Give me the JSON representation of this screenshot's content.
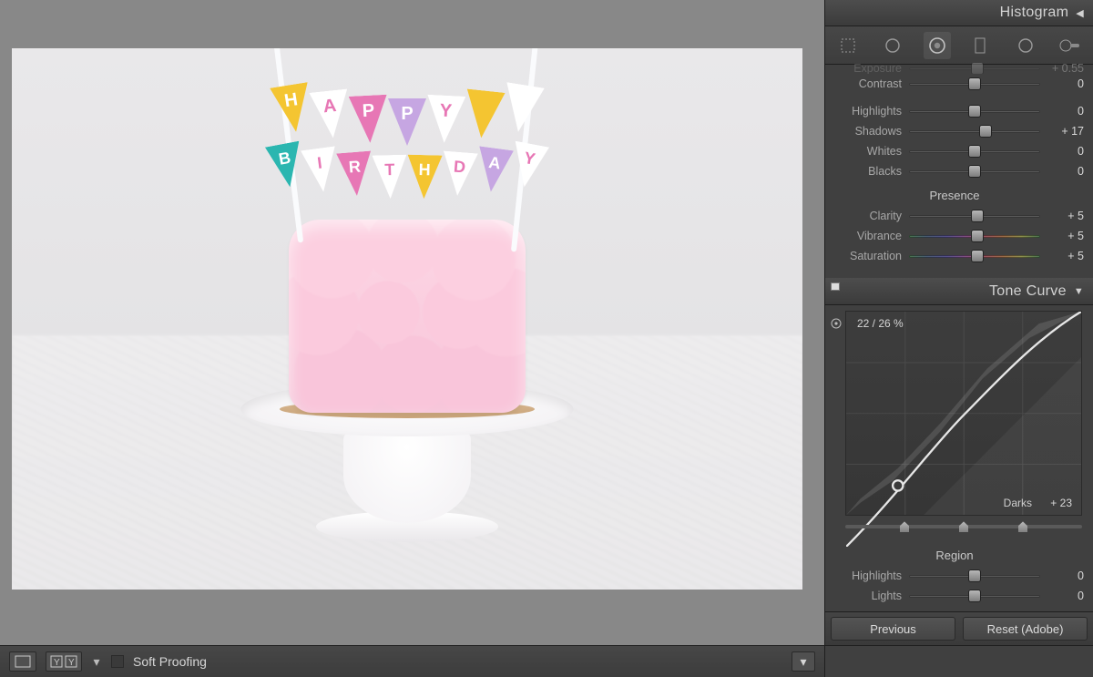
{
  "panels": {
    "histogram_title": "Histogram",
    "tone_curve_title": "Tone Curve",
    "region_title": "Region",
    "presence_title": "Presence"
  },
  "basic": {
    "exposure": {
      "label": "Exposure",
      "value": "+ 0.55",
      "pos": 52
    },
    "contrast": {
      "label": "Contrast",
      "value": "0",
      "pos": 50
    },
    "highlights": {
      "label": "Highlights",
      "value": "0",
      "pos": 50
    },
    "shadows": {
      "label": "Shadows",
      "value": "+ 17",
      "pos": 58
    },
    "whites": {
      "label": "Whites",
      "value": "0",
      "pos": 50
    },
    "blacks": {
      "label": "Blacks",
      "value": "0",
      "pos": 50
    }
  },
  "presence": {
    "clarity": {
      "label": "Clarity",
      "value": "+ 5",
      "pos": 52
    },
    "vibrance": {
      "label": "Vibrance",
      "value": "+ 5",
      "pos": 52
    },
    "saturation": {
      "label": "Saturation",
      "value": "+ 5",
      "pos": 52
    }
  },
  "tone_curve": {
    "readout": "22 / 26 %",
    "range_label": "Darks",
    "range_value": "+ 23",
    "splits": [
      25,
      50,
      75
    ]
  },
  "region": {
    "highlights": {
      "label": "Highlights",
      "value": "0",
      "pos": 50
    },
    "lights": {
      "label": "Lights",
      "value": "0",
      "pos": 50
    }
  },
  "buttons": {
    "previous": "Previous",
    "reset": "Reset (Adobe)"
  },
  "bottom": {
    "soft_proofing": "Soft Proofing"
  },
  "banner": {
    "row1": [
      {
        "t": "H",
        "c": "#f4c531"
      },
      {
        "t": "A",
        "c": "#ffffff"
      },
      {
        "t": "P",
        "c": "#e777b5"
      },
      {
        "t": "P",
        "c": "#c6a6e2"
      },
      {
        "t": "Y",
        "c": "#ffffff"
      },
      {
        "t": "",
        "c": "#f4c531"
      },
      {
        "t": "",
        "c": "#ffffff"
      }
    ],
    "row2": [
      {
        "t": "B",
        "c": "#2bb6b0"
      },
      {
        "t": "I",
        "c": "#ffffff"
      },
      {
        "t": "R",
        "c": "#e777b5"
      },
      {
        "t": "T",
        "c": "#ffffff"
      },
      {
        "t": "H",
        "c": "#f4c531"
      },
      {
        "t": "D",
        "c": "#ffffff"
      },
      {
        "t": "A",
        "c": "#c6a6e2"
      },
      {
        "t": "Y",
        "c": "#ffffff"
      }
    ]
  }
}
